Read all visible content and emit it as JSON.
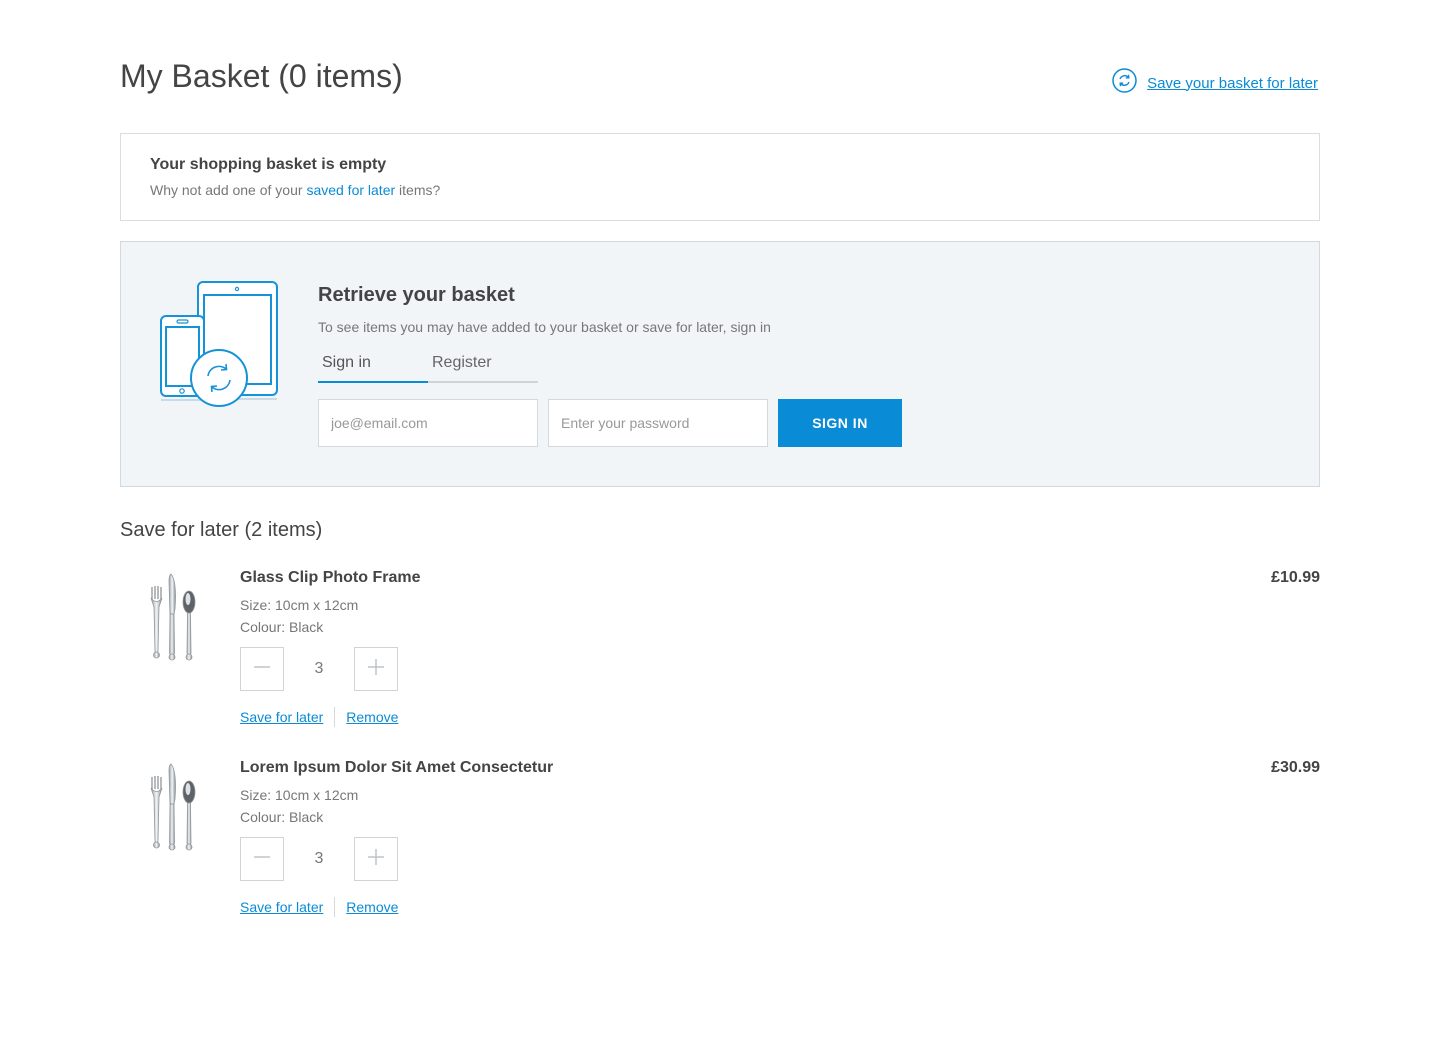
{
  "header": {
    "title": "My Basket (0 items)",
    "save_link": "Save your basket for later",
    "save_icon": "sync-icon"
  },
  "empty_basket": {
    "title": "Your shopping basket is empty",
    "sub_before": "Why not add one of your ",
    "sub_link": "saved for later",
    "sub_after": " items?"
  },
  "retrieve": {
    "title": "Retrieve your basket",
    "subtitle": "To see items you may have added to your basket or save for later, sign in",
    "tabs": [
      {
        "label": "Sign in",
        "active": true
      },
      {
        "label": "Register",
        "active": false
      }
    ],
    "email_placeholder": "joe@email.com",
    "password_placeholder": "Enter your password",
    "signin_label": "SIGN IN",
    "illustration_icon": "devices-sync-icon"
  },
  "saved": {
    "title": "Save for later (2 items)",
    "items": [
      {
        "name": "Glass Clip Photo Frame",
        "price": "£10.99",
        "size": "Size: 10cm x 12cm",
        "colour": "Colour: Black",
        "quantity": "3",
        "save_label": "Save for later",
        "remove_label": "Remove",
        "thumb_icon": "cutlery-icon"
      },
      {
        "name": "Lorem Ipsum Dolor Sit Amet Consectetur",
        "price": "£30.99",
        "size": "Size: 10cm x 12cm",
        "colour": "Colour: Black",
        "quantity": "3",
        "save_label": "Save for later",
        "remove_label": "Remove",
        "thumb_icon": "cutlery-icon"
      }
    ]
  },
  "colors": {
    "accent": "#0a8bd6",
    "panel_bg": "#f1f5f8",
    "border": "#d9dde1"
  }
}
